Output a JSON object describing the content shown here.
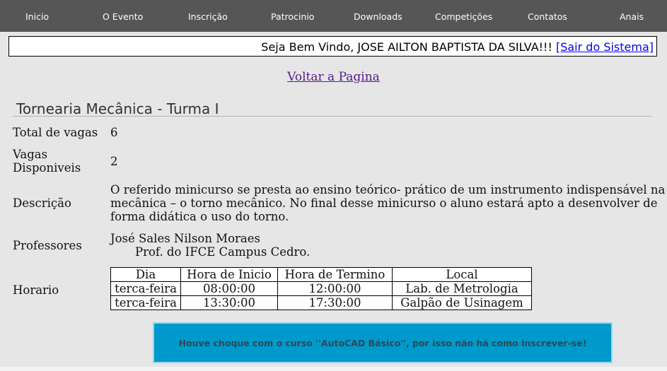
{
  "nav": {
    "items": [
      "Inicio",
      "O Evento",
      "Inscrição",
      "Patrocinio",
      "Downloads",
      "Competições",
      "Contatos",
      "Anais"
    ]
  },
  "welcome": {
    "text": "Seja Bem Vindo, JOSE AILTON BAPTISTA DA SILVA!!! ",
    "logout_label": "[Sair do Sistema]"
  },
  "back_link": "Voltar a Pagina",
  "course": {
    "title": "Tornearia Mecânica - Turma I",
    "total_label": "Total de vagas",
    "total_value": "6",
    "available_label_1": "Vagas",
    "available_label_2": "Disponiveis",
    "available_value": "2",
    "description_label": "Descrição",
    "description_lines": [
      "O referido minicurso se presta ao ensino teórico- prático de um instrumento indispensável na",
      "mecânica – o torno mecânico. No final desse minicurso o aluno estará apto a desenvolver de",
      "forma didática o uso do torno."
    ],
    "professors_label": "Professores",
    "professor_name": "José Sales Nilson Moraes",
    "professor_role": "Prof. do IFCE Campus Cedro.",
    "schedule_label": "Horario"
  },
  "schedule": {
    "headers": [
      "Dia",
      "Hora de Inicio",
      "Hora de Termino",
      "Local"
    ],
    "rows": [
      [
        "terca-feira",
        "08:00:00",
        "12:00:00",
        "Lab. de Metrologia"
      ],
      [
        "terca-feira",
        "13:30:00",
        "17:30:00",
        "Galpão de Usinagem"
      ]
    ]
  },
  "notice": "Houve choque com o curso ''AutoCAD Básico'', por isso não há como inscrever-se!",
  "colors": {
    "nav_bg": "#565656",
    "page_bg": "#e6e6e6",
    "notice_bg": "#0099cc"
  }
}
